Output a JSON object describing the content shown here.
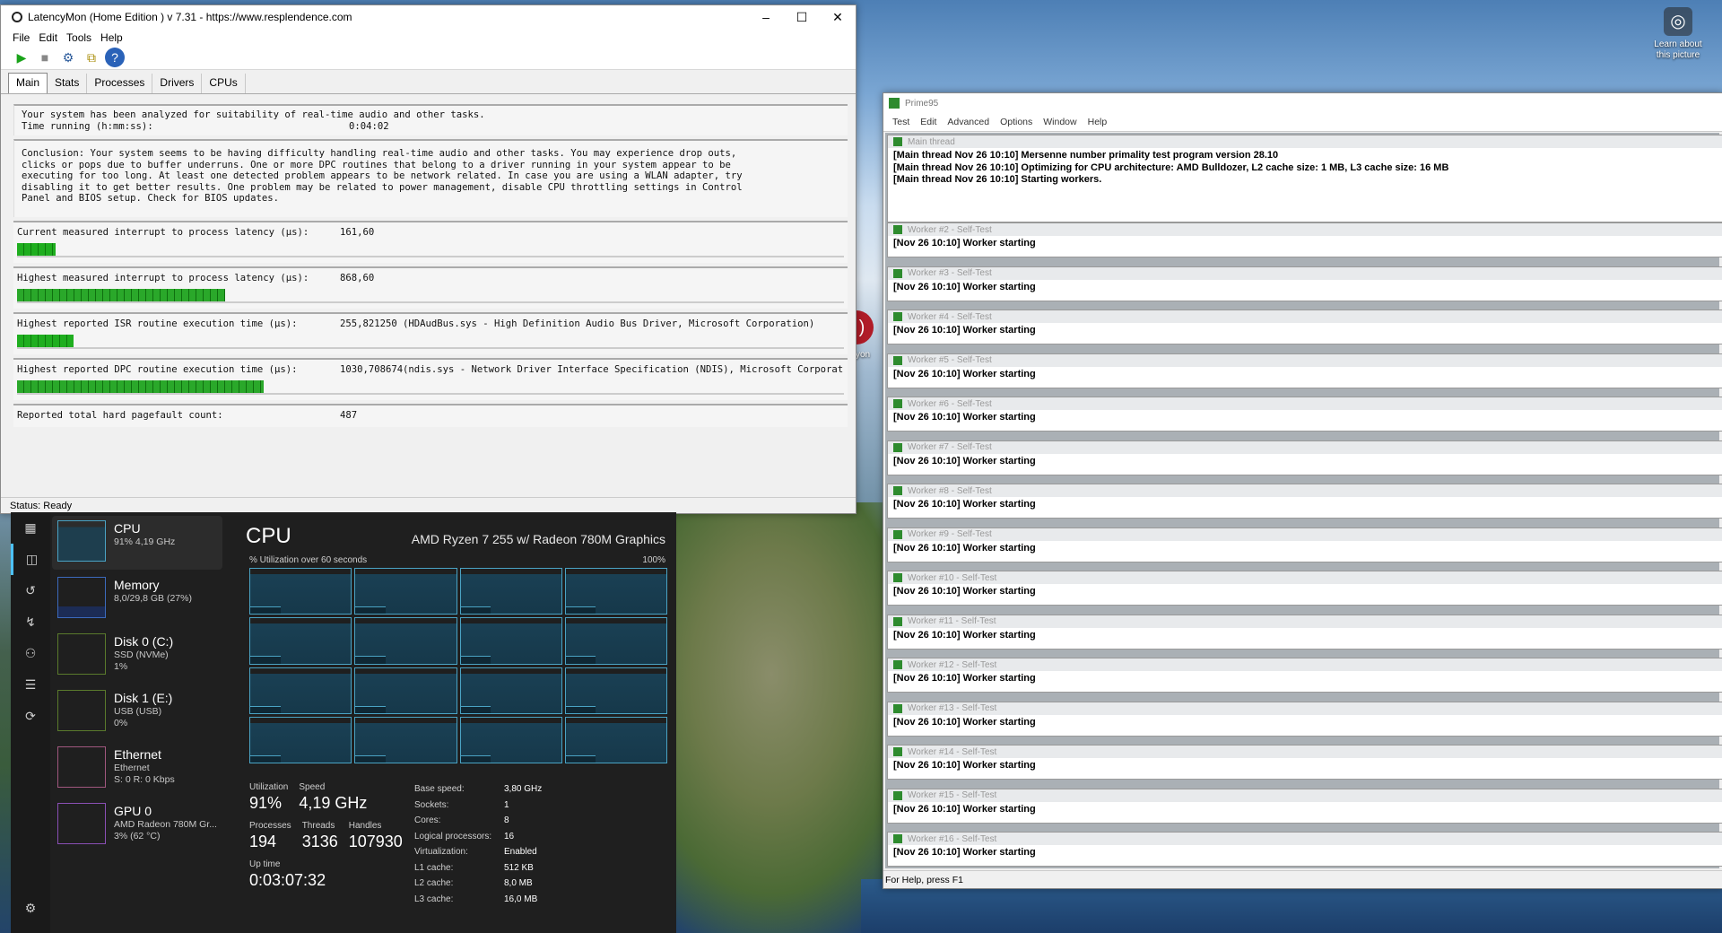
{
  "desktop": {
    "learn_about": "Learn about this picture",
    "red_icon_label": "yon"
  },
  "latencymon": {
    "title": "LatencyMon  (Home Edition )  v 7.31 - https://www.resplendence.com",
    "menu": [
      "File",
      "Edit",
      "Tools",
      "Help"
    ],
    "tabs": [
      "Main",
      "Stats",
      "Processes",
      "Drivers",
      "CPUs"
    ],
    "intro_line1": "Your system has been analyzed for suitability of real-time audio and other tasks.",
    "time_running_label": "Time running (h:mm:ss):",
    "time_running_value": "0:04:02",
    "conclusion": "Conclusion: Your system seems to be having difficulty handling real-time audio and other tasks. You may experience drop outs,\nclicks or pops due to buffer underruns. One or more DPC routines that belong to a driver running in your system appear to be\nexecuting for too long. At least one detected problem appears to be network related. In case you are using a WLAN adapter, try\ndisabling it to get better results. One problem may be related to power management, disable CPU throttling settings in Control\nPanel and BIOS setup. Check for BIOS updates.",
    "metrics": [
      {
        "label": "Current measured interrupt to process latency (µs):",
        "value": "161,60",
        "extra": "",
        "bar": 0.047
      },
      {
        "label": "Highest measured interrupt to process latency (µs):",
        "value": "868,60",
        "extra": "",
        "bar": 0.252
      },
      {
        "label": "Highest reported ISR routine execution time (µs):",
        "value": "255,821250",
        "extra": "(HDAudBus.sys - High Definition Audio Bus Driver, Microsoft Corporation)",
        "bar": 0.068
      },
      {
        "label": "Highest reported DPC routine execution time (µs):",
        "value": "1030,708674",
        "extra": "(ndis.sys - Network Driver Interface Specification (NDIS), Microsoft Corporati",
        "bar": 0.298
      },
      {
        "label": "Reported total hard pagefault count:",
        "value": "487",
        "extra": "",
        "bar": null
      }
    ],
    "status": "Status: Ready"
  },
  "taskmanager": {
    "items": [
      {
        "name": "CPU",
        "sub1": "91% 4,19 GHz",
        "sub2": "",
        "sub3": ""
      },
      {
        "name": "Memory",
        "sub1": "8,0/29,8 GB (27%)",
        "sub2": "",
        "sub3": ""
      },
      {
        "name": "Disk 0 (C:)",
        "sub1": "SSD (NVMe)",
        "sub2": "1%",
        "sub3": ""
      },
      {
        "name": "Disk 1 (E:)",
        "sub1": "USB (USB)",
        "sub2": "0%",
        "sub3": ""
      },
      {
        "name": "Ethernet",
        "sub1": "Ethernet",
        "sub2": "S: 0  R: 0 Kbps",
        "sub3": ""
      },
      {
        "name": "GPU 0",
        "sub1": "AMD Radeon 780M Gr...",
        "sub2": "3% (62 °C)",
        "sub3": ""
      }
    ],
    "heading": "CPU",
    "model": "AMD Ryzen 7 255 w/ Radeon 780M Graphics",
    "util_label": "% Utilization over 60 seconds",
    "util_max": "100%",
    "utilization_label": "Utilization",
    "utilization": "91%",
    "speed_label": "Speed",
    "speed": "4,19 GHz",
    "processes_label": "Processes",
    "processes": "194",
    "threads_label": "Threads",
    "threads": "3136",
    "handles_label": "Handles",
    "handles": "107930",
    "uptime_label": "Up time",
    "uptime": "0:03:07:32",
    "details": [
      {
        "k": "Base speed:",
        "v": "3,80 GHz"
      },
      {
        "k": "Sockets:",
        "v": "1"
      },
      {
        "k": "Cores:",
        "v": "8"
      },
      {
        "k": "Logical processors:",
        "v": "16"
      },
      {
        "k": "Virtualization:",
        "v": "Enabled"
      },
      {
        "k": "L1 cache:",
        "v": "512 KB"
      },
      {
        "k": "L2 cache:",
        "v": "8,0 MB"
      },
      {
        "k": "L3 cache:",
        "v": "16,0 MB"
      }
    ]
  },
  "prime95": {
    "title": "Prime95",
    "menu": [
      "Test",
      "Edit",
      "Advanced",
      "Options",
      "Window",
      "Help"
    ],
    "main_caption": "Main thread",
    "main_log": [
      "[Main thread Nov 26 10:10] Mersenne number primality test program version 28.10",
      "[Main thread Nov 26 10:10] Optimizing for CPU architecture: AMD Bulldozer, L2 cache size: 1 MB, L3 cache size: 16 MB",
      "[Main thread Nov 26 10:10] Starting workers."
    ],
    "workers": [
      {
        "caption": "Worker #2 - Self-Test",
        "log": "[Nov 26 10:10] Worker starting"
      },
      {
        "caption": "Worker #3 - Self-Test",
        "log": "[Nov 26 10:10] Worker starting"
      },
      {
        "caption": "Worker #4 - Self-Test",
        "log": "[Nov 26 10:10] Worker starting"
      },
      {
        "caption": "Worker #5 - Self-Test",
        "log": "[Nov 26 10:10] Worker starting"
      },
      {
        "caption": "Worker #6 - Self-Test",
        "log": "[Nov 26 10:10] Worker starting"
      },
      {
        "caption": "Worker #7 - Self-Test",
        "log": "[Nov 26 10:10] Worker starting"
      },
      {
        "caption": "Worker #8 - Self-Test",
        "log": "[Nov 26 10:10] Worker starting"
      },
      {
        "caption": "Worker #9 - Self-Test",
        "log": "[Nov 26 10:10] Worker starting"
      },
      {
        "caption": "Worker #10 - Self-Test",
        "log": "[Nov 26 10:10] Worker starting"
      },
      {
        "caption": "Worker #11 - Self-Test",
        "log": "[Nov 26 10:10] Worker starting"
      },
      {
        "caption": "Worker #12 - Self-Test",
        "log": "[Nov 26 10:10] Worker starting"
      },
      {
        "caption": "Worker #13 - Self-Test",
        "log": "[Nov 26 10:10] Worker starting"
      },
      {
        "caption": "Worker #14 - Self-Test",
        "log": "[Nov 26 10:10] Worker starting"
      },
      {
        "caption": "Worker #15 - Self-Test",
        "log": "[Nov 26 10:10] Worker starting"
      },
      {
        "caption": "Worker #16 - Self-Test",
        "log": "[Nov 26 10:10] Worker starting"
      }
    ],
    "status": "For Help, press F1"
  }
}
